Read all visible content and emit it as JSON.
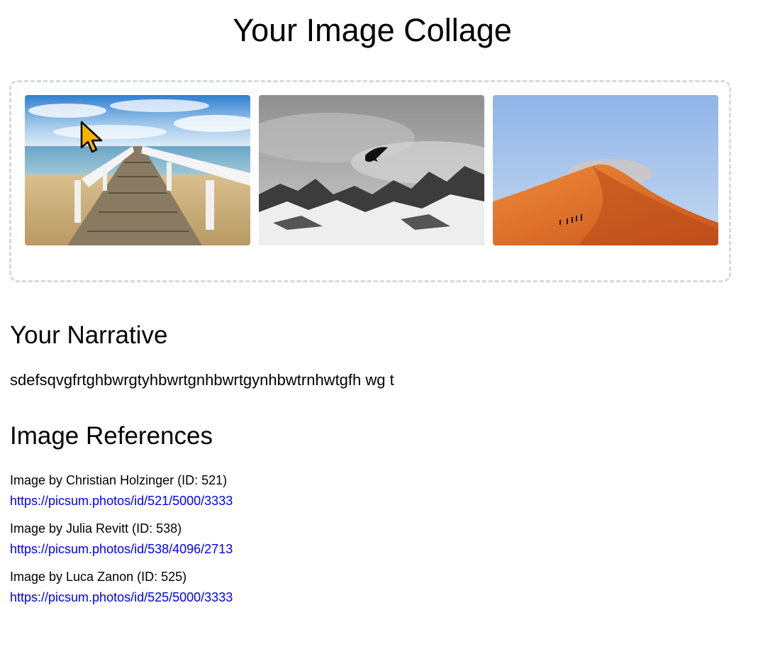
{
  "page": {
    "title": "Your Image Collage"
  },
  "collage": {
    "images": [
      {
        "alt": "wooden pier over the sea",
        "icon": "pier-image"
      },
      {
        "alt": "bird over snowy mountains",
        "icon": "mountain-image"
      },
      {
        "alt": "orange sand dune",
        "icon": "dune-image"
      }
    ]
  },
  "narrative": {
    "heading": "Your Narrative",
    "text": "sdefsqvgfrtghbwrgtyhbwrtgnhbwrtgynhbwtrnhwtgfh wg  t"
  },
  "references": {
    "heading": "Image References",
    "items": [
      {
        "credit": "Image by Christian Holzinger (ID: 521)",
        "url": "https://picsum.photos/id/521/5000/3333"
      },
      {
        "credit": "Image by Julia Revitt (ID: 538)",
        "url": "https://picsum.photos/id/538/4096/2713"
      },
      {
        "credit": "Image by Luca Zanon (ID: 525)",
        "url": "https://picsum.photos/id/525/5000/3333"
      }
    ]
  },
  "colors": {
    "link": "#0000ee",
    "frame_border": "#d8d8d8",
    "cursor_fill": "#f5b400"
  },
  "cursor": {
    "icon": "mouse-pointer-icon"
  }
}
